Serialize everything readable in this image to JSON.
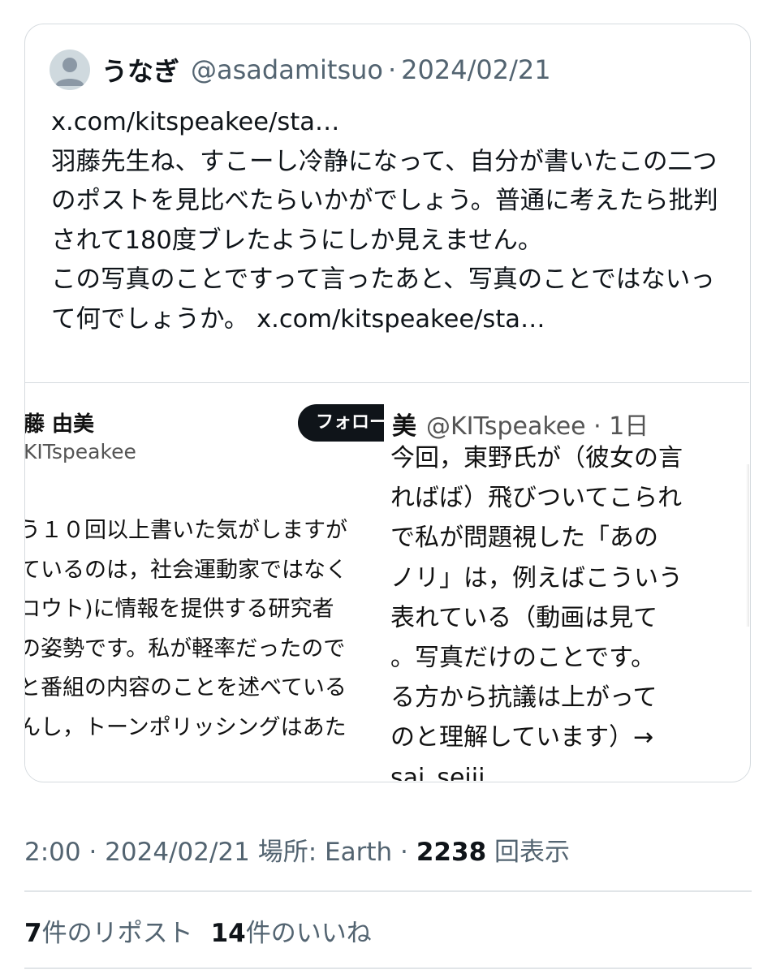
{
  "quote": {
    "author_name": "うなぎ",
    "author_handle": "@asadamitsuo",
    "separator": "·",
    "date": "2024/02/21",
    "body": "x.com/kitspeakee/sta…\n羽藤先生ね、すこーし冷静になって、自分が書いたこの二つのポストを見比べたらいかがでしょう。普通に考えたら批判されて180度ブレたようにしか見えません。\nこの写真のことですって言ったあと、写真のことではないって何でしょうか。 x.com/kitspeakee/sta…"
  },
  "media": {
    "left": {
      "name": "藤 由美",
      "handle": "KITspeakee",
      "follow_label": "フォロー",
      "lines": [
        "う１０回以上書いた気がしますが",
        "ているのは，社会運動家ではなく",
        "ロウト)に情報を提供する研究者",
        "の姿勢です。私が軽率だったので",
        "と番組の内容のことを述べている",
        "んし，トーンポリッシングはあた"
      ]
    },
    "right": {
      "name": "美",
      "handle": "@KITspeakee · 1日",
      "lines": [
        "今回，東野氏が（彼女の言",
        "ればば）飛びついてこられ",
        "で私が問題視した「あの",
        "ノリ」は，例えばこういう",
        "表れている（動画は見て",
        "。写真だけのことです。",
        "る方から抗議は上がって",
        "のと理解しています）→",
        "sai_seiji"
      ]
    }
  },
  "meta": {
    "time": "2:00 · 2024/02/21",
    "location": "場所: Earth ·",
    "views_count": "2238",
    "views_label": "回表示"
  },
  "stats": {
    "reposts_count": "7",
    "reposts_label": "件のリポスト",
    "likes_count": "14",
    "likes_label": "件のいいね"
  }
}
